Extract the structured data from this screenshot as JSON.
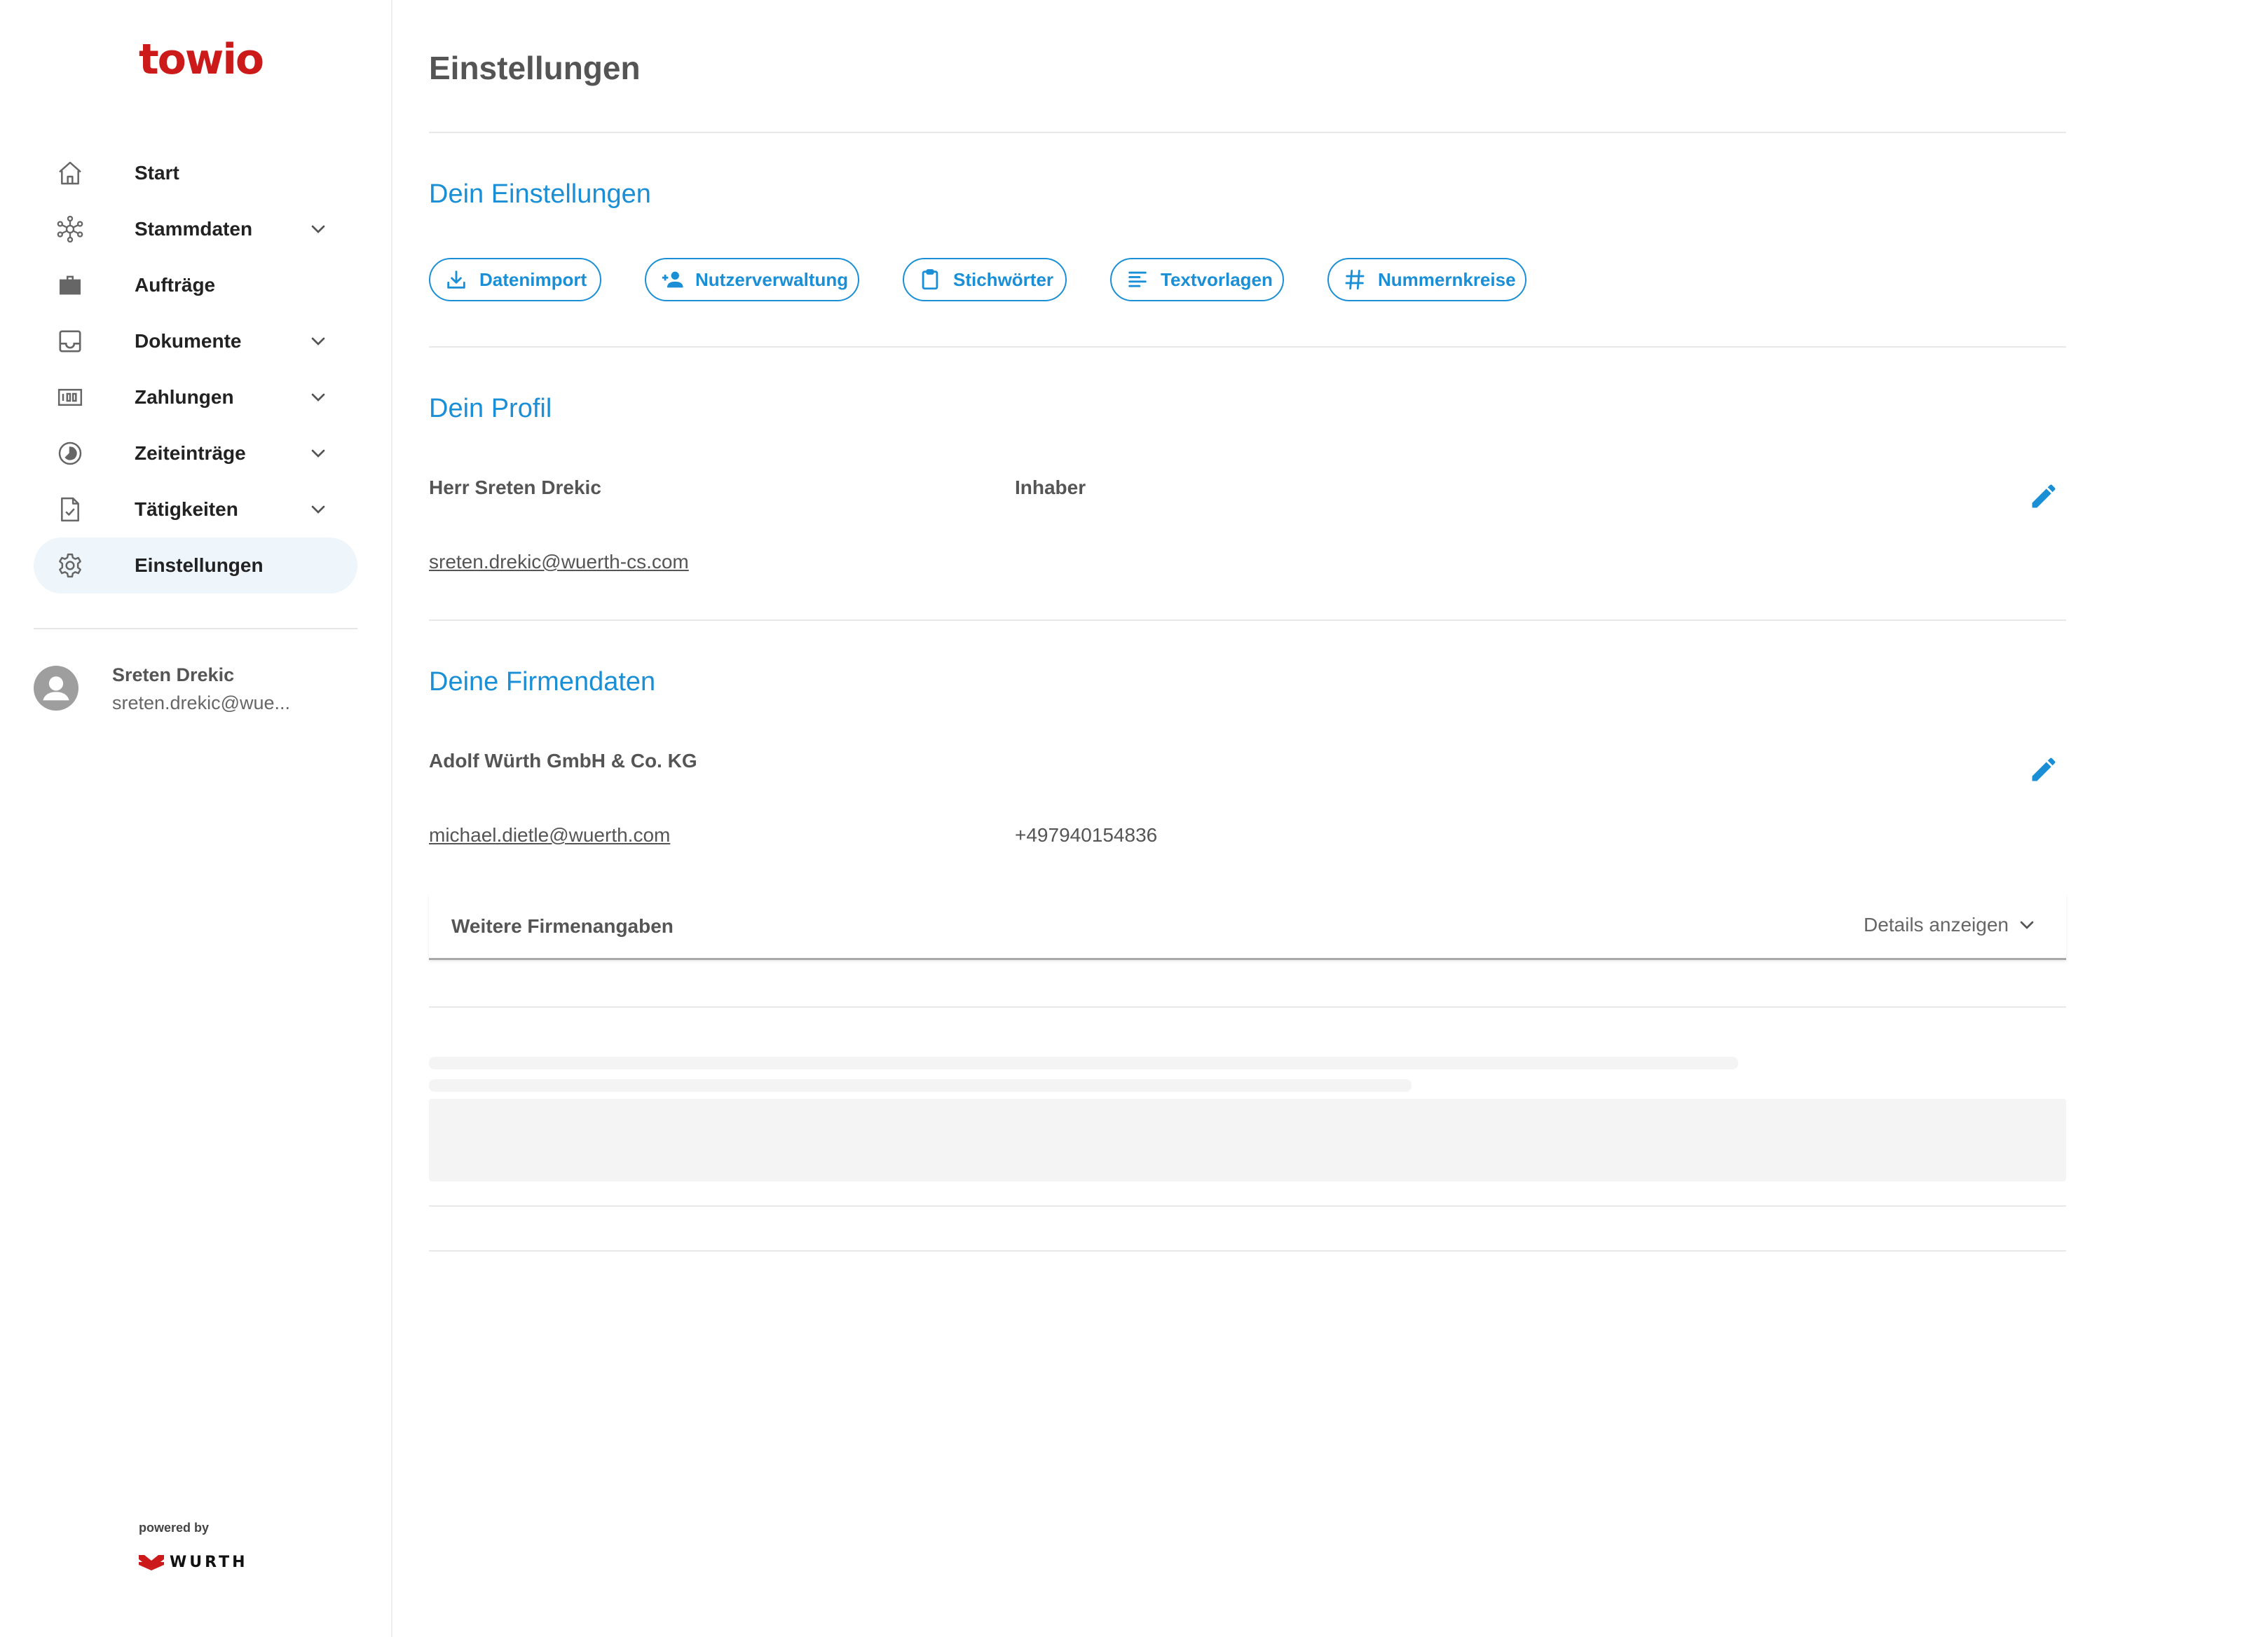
{
  "sidebar": {
    "logo": "towio",
    "nav": [
      {
        "label": "Start",
        "icon": "home-icon"
      },
      {
        "label": "Stammdaten",
        "icon": "network-icon",
        "expandable": true
      },
      {
        "label": "Aufträge",
        "icon": "briefcase-icon"
      },
      {
        "label": "Dokumente",
        "icon": "inbox-icon",
        "expandable": true
      },
      {
        "label": "Zahlungen",
        "icon": "counter-icon",
        "expandable": true
      },
      {
        "label": "Zeiteinträge",
        "icon": "clock-icon",
        "expandable": true
      },
      {
        "label": "Tätigkeiten",
        "icon": "task-icon",
        "expandable": true
      },
      {
        "label": "Einstellungen",
        "icon": "gear-icon",
        "active": true
      }
    ],
    "user": {
      "name": "Sreten Drekic",
      "email": "sreten.drekic@wue..."
    },
    "powered_by": "powered by",
    "brand": "WURTH"
  },
  "main": {
    "title": "Einstellungen",
    "settings_section": {
      "title": "Dein Einstellungen",
      "chips": [
        {
          "label": "Datenimport",
          "icon": "download-icon"
        },
        {
          "label": "Nutzerverwaltung",
          "icon": "person-add-icon"
        },
        {
          "label": "Stichwörter",
          "icon": "clipboard-icon"
        },
        {
          "label": "Textvorlagen",
          "icon": "text-lines-icon"
        },
        {
          "label": "Nummernkreise",
          "icon": "hash-icon"
        }
      ]
    },
    "profile_section": {
      "title": "Dein Profil",
      "name": "Herr Sreten Drekic",
      "role": "Inhaber",
      "email": "sreten.drekic@wuerth-cs.com"
    },
    "company_section": {
      "title": "Deine Firmendaten",
      "company_name": "Adolf Würth GmbH & Co. KG",
      "email": "michael.dietle@wuerth.com",
      "phone": "+497940154836",
      "accordion_title": "Weitere Firmenangaben",
      "accordion_toggle": "Details anzeigen"
    }
  },
  "colors": {
    "brand_red": "#cc1a1a",
    "accent_blue": "#1b8fd6",
    "active_nav_bg": "#eef5fb",
    "text_gray": "#555555"
  }
}
